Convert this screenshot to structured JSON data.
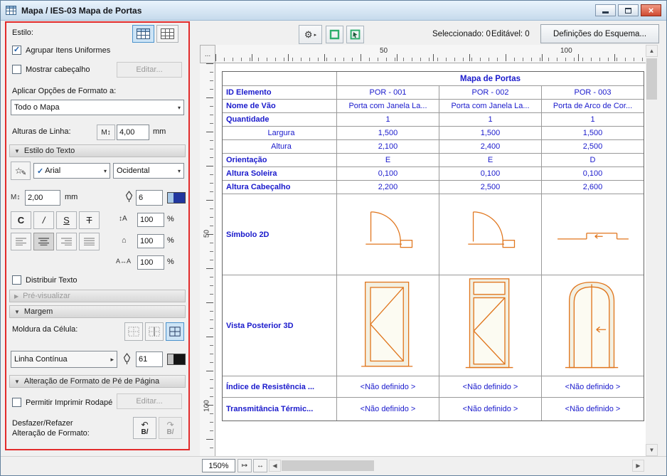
{
  "window": {
    "title": "Mapa / IES-03 Mapa de Portas"
  },
  "colors": {
    "accent_blue": "#cde4f6",
    "selection_border": "#4a92cc",
    "table_text_blue": "#1a1acc",
    "drawing_orange": "#e0751c",
    "annotation_red": "#e22b2b",
    "close_button_red": "#cf4a31"
  },
  "icons": {
    "gear": "⚙",
    "menu_arrow": "▸",
    "combo_arrow": "▾",
    "check": "✓",
    "star": "☆",
    "pencil": "✎",
    "updown": "↕",
    "house": "⌂",
    "leftright": "↔",
    "undo": "↶",
    "redo": "↷",
    "close": "×",
    "left": "◀",
    "right": "▶",
    "up": "▲",
    "down": "▼",
    "section_open": "▼",
    "section_closed": "▶",
    "step": "↦",
    "letter_m": "M",
    "letter_a": "A",
    "bi_label": "B/"
  },
  "toolbar": {
    "selected_label": "Seleccionado: 0",
    "editable_label": "Editável: 0",
    "scheme_button": "Definições do Esquema..."
  },
  "panel": {
    "estilo_label": "Estilo:",
    "agrupar_checkbox": "Agrupar Itens Uniformes",
    "mostrar_checkbox": "Mostrar cabeçalho",
    "editar_button": "Editar...",
    "aplicar_label": "Aplicar Opções de Formato a:",
    "aplicar_value": "Todo o Mapa",
    "alturas_label": "Alturas de Linha:",
    "alturas_value": "4,00",
    "alturas_unit": "mm",
    "estilo_texto_section": "Estilo do Texto",
    "font_value": "Arial",
    "script_value": "Ocidental",
    "size_value": "2,00",
    "size_unit": "mm",
    "pen_value": "6",
    "bold_label": "C",
    "italic_label": "/",
    "underline_label": "S",
    "strike_label": "T",
    "line_spacing_value": "100",
    "para_spacing_value": "100",
    "char_spacing_value": "100",
    "percent": "%",
    "distribuir_checkbox": "Distribuir Texto",
    "previsualizar_section": "Pré-visualizar",
    "margem_section": "Margem",
    "moldura_label": "Moldura da Célula:",
    "linha_value": "Linha Contínua",
    "pen2_value": "61",
    "rodape_section": "Alteração de Formato de Pé de Página",
    "permitir_checkbox": "Permitir Imprimir Rodapé",
    "editar2_button": "Editar...",
    "desfazer_label1": "Desfazer/Refazer",
    "desfazer_label2": "Alteração de Formato:"
  },
  "ruler": {
    "corner": "...",
    "h_labels": [
      "50",
      "100"
    ],
    "v_labels": [
      "50",
      "100"
    ]
  },
  "schedule": {
    "title": "Mapa de Portas",
    "rows": [
      {
        "label": "ID Elemento",
        "values": [
          "POR - 001",
          "POR - 002",
          "POR - 003"
        ]
      },
      {
        "label": "Nome de Vão",
        "values": [
          "Porta com Janela La...",
          "Porta com Janela La...",
          "Porta de Arco de Cor..."
        ]
      },
      {
        "label": "Quantidade",
        "values": [
          "1",
          "1",
          "1"
        ]
      },
      {
        "label": "Largura",
        "values": [
          "1,500",
          "1,500",
          "1,500"
        ]
      },
      {
        "label": "Altura",
        "values": [
          "2,100",
          "2,400",
          "2,500"
        ]
      },
      {
        "label": "Orientação",
        "values": [
          "E",
          "E",
          "D"
        ]
      },
      {
        "label": "Altura Soleira",
        "values": [
          "0,100",
          "0,100",
          "0,100"
        ]
      },
      {
        "label": "Altura Cabeçalho",
        "values": [
          "2,200",
          "2,500",
          "2,600"
        ]
      },
      {
        "label": "Símbolo 2D",
        "values": [
          "",
          "",
          ""
        ]
      },
      {
        "label": "Vista Posterior 3D",
        "values": [
          "",
          "",
          ""
        ]
      },
      {
        "label": "Índice de Resistência ...",
        "values": [
          "<Não definido >",
          "<Não definido >",
          "<Não definido >"
        ]
      },
      {
        "label": "Transmitância Térmic...",
        "values": [
          "<Não definido >",
          "<Não definido >",
          "<Não definido >"
        ]
      }
    ]
  },
  "statusbar": {
    "zoom": "150%"
  }
}
